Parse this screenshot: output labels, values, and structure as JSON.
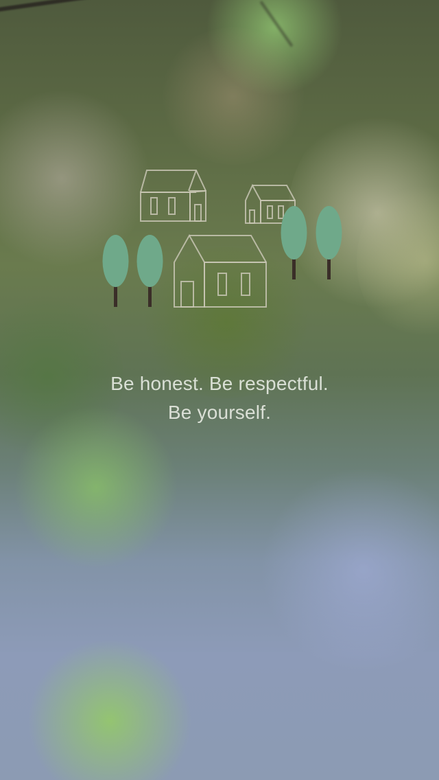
{
  "onboarding": {
    "tagline_line1": "Be honest. Be respectful.",
    "tagline_line2": "Be yourself."
  },
  "illustration": {
    "icons": [
      "house-icon",
      "house-icon",
      "house-icon",
      "tree-icon",
      "tree-icon",
      "tree-icon",
      "tree-icon"
    ],
    "colors": {
      "house_outline": "#c8c6b4",
      "tree_foliage": "#6fa98a",
      "tree_trunk": "#3a2e28"
    }
  }
}
